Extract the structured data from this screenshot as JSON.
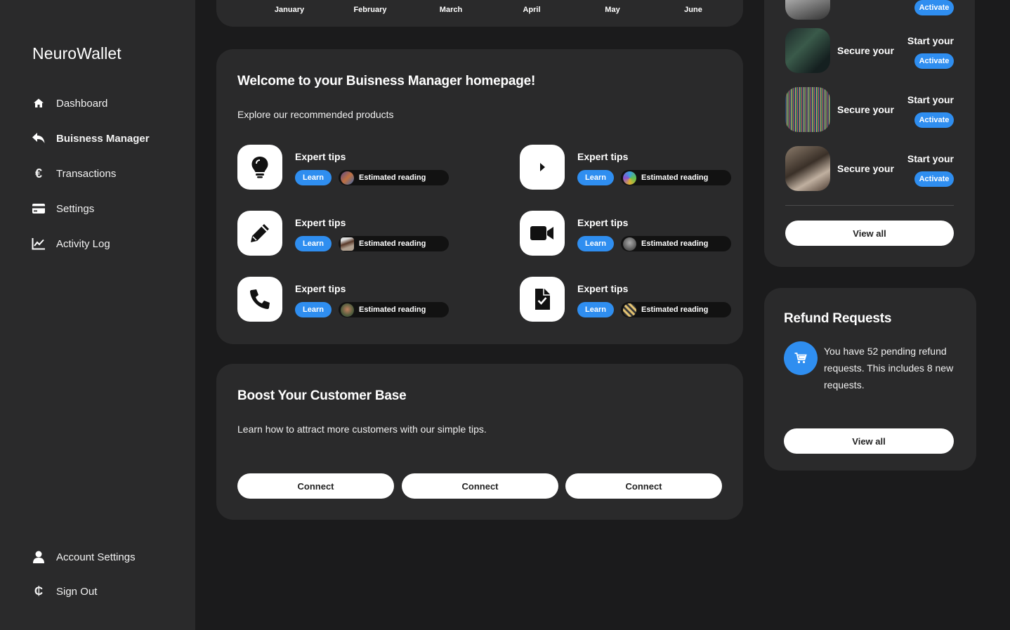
{
  "app": {
    "brand": "NeuroWallet"
  },
  "sidebar": {
    "items": [
      {
        "label": "Dashboard",
        "icon": "home-icon"
      },
      {
        "label": "Buisness Manager",
        "icon": "reply-arrow-icon",
        "active": true
      },
      {
        "label": "Transactions",
        "icon": "euro-icon"
      },
      {
        "label": "Settings",
        "icon": "credit-card-icon"
      },
      {
        "label": "Activity Log",
        "icon": "line-chart-icon"
      }
    ],
    "bottom": [
      {
        "label": "Account Settings",
        "icon": "user-icon"
      },
      {
        "label": "Sign Out",
        "icon": "cedi-sign-icon"
      }
    ]
  },
  "chart_months": [
    "January",
    "February",
    "March",
    "April",
    "May",
    "June"
  ],
  "welcome": {
    "title": "Welcome to your Buisness Manager homepage!",
    "subtitle": "Explore our recommended products",
    "tips": [
      {
        "title": "Expert tips",
        "learn": "Learn",
        "estimate": "Estimated reading",
        "icon": "lightbulb-icon"
      },
      {
        "title": "Expert tips",
        "learn": "Learn",
        "estimate": "Estimated reading",
        "icon": "play-icon"
      },
      {
        "title": "Expert tips",
        "learn": "Learn",
        "estimate": "Estimated reading",
        "icon": "pencil-icon"
      },
      {
        "title": "Expert tips",
        "learn": "Learn",
        "estimate": "Estimated reading",
        "icon": "video-camera-icon"
      },
      {
        "title": "Expert tips",
        "learn": "Learn",
        "estimate": "Estimated reading",
        "icon": "phone-icon"
      },
      {
        "title": "Expert tips",
        "learn": "Learn",
        "estimate": "Estimated reading",
        "icon": "file-check-icon"
      }
    ]
  },
  "boost": {
    "title": "Boost Your Customer Base",
    "subtitle": "Learn how to attract more customers with our simple tips.",
    "buttons": [
      "Connect",
      "Connect",
      "Connect"
    ]
  },
  "secure": {
    "top_activate": "Activate",
    "rows": [
      {
        "text": "Secure your",
        "start": "Start your",
        "action": "Activate"
      },
      {
        "text": "Secure your",
        "start": "Start your",
        "action": "Activate"
      },
      {
        "text": "Secure your",
        "start": "Start your",
        "action": "Activate"
      }
    ],
    "view_all": "View all"
  },
  "refund": {
    "title": "Refund Requests",
    "text": "You have 52 pending refund requests. This includes 8 new requests.",
    "view_all": "View all"
  },
  "colors": {
    "accent": "#2f8ef0",
    "card": "#2a2a2b",
    "background": "#1b1b1c"
  }
}
